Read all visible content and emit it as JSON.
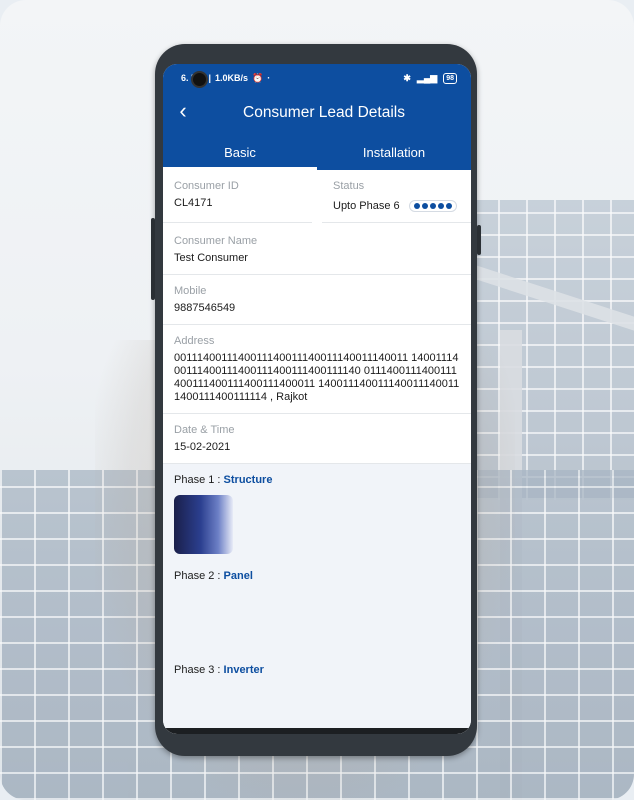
{
  "status_bar": {
    "time": "6.  PM",
    "speed": "1.0KB/s",
    "battery": "98"
  },
  "app_bar": {
    "back_icon": "chevron-left-icon",
    "title": "Consumer Lead Details"
  },
  "tabs": [
    {
      "label": "Basic",
      "active": true
    },
    {
      "label": "Installation",
      "active": false
    }
  ],
  "details": {
    "consumer_id": {
      "label": "Consumer ID",
      "value": "CL4171"
    },
    "status": {
      "label": "Status",
      "value": "Upto Phase 6",
      "dots": 5
    },
    "consumer_name": {
      "label": "Consumer Name",
      "value": "Test Consumer"
    },
    "mobile": {
      "label": "Mobile",
      "value": "9887546549"
    },
    "address": {
      "label": "Address",
      "value": "0011140011140011140011140011140011140011 1400111400111400111400111400111400111140 0111400111400111400111400111400111400011 1400111400111400111400111400111400111114 , Rajkot"
    },
    "date_time": {
      "label": "Date & Time",
      "value": "15-02-2021"
    }
  },
  "phases": [
    {
      "prefix": "Phase 1 :",
      "name": "Structure"
    },
    {
      "prefix": "Phase 2 :",
      "name": "Panel"
    },
    {
      "prefix": "Phase 3 :",
      "name": "Inverter"
    }
  ],
  "colors": {
    "primary": "#0d4ea0",
    "muted_label": "#9aa0a6",
    "phase_background": "#f1f4f9"
  }
}
